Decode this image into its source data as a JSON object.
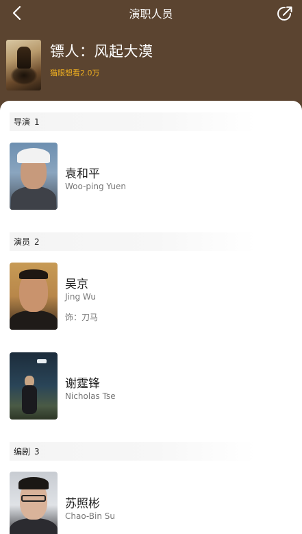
{
  "nav": {
    "title": "演职人员"
  },
  "movie": {
    "title": "镖人：风起大漠",
    "want": "猫眼想看2.0万"
  },
  "sections": [
    {
      "label": "导演",
      "count": "1",
      "people": [
        {
          "name": "袁和平",
          "en": "Woo-ping Yuen",
          "role": ""
        }
      ]
    },
    {
      "label": "演员",
      "count": "2",
      "people": [
        {
          "name": "吴京",
          "en": "Jing Wu",
          "role": "饰：刀马"
        },
        {
          "name": "谢霆锋",
          "en": "Nicholas Tse",
          "role": ""
        }
      ]
    },
    {
      "label": "编剧",
      "count": "3",
      "people": [
        {
          "name": "苏照彬",
          "en": "Chao-Bin Su",
          "role": ""
        }
      ]
    }
  ],
  "icons": {
    "back": "chevron-left-icon",
    "share": "share-icon"
  },
  "colors": {
    "header_bg": "#5b4430",
    "want_accent": "#f0b020",
    "content_bg": "#ffffff"
  }
}
